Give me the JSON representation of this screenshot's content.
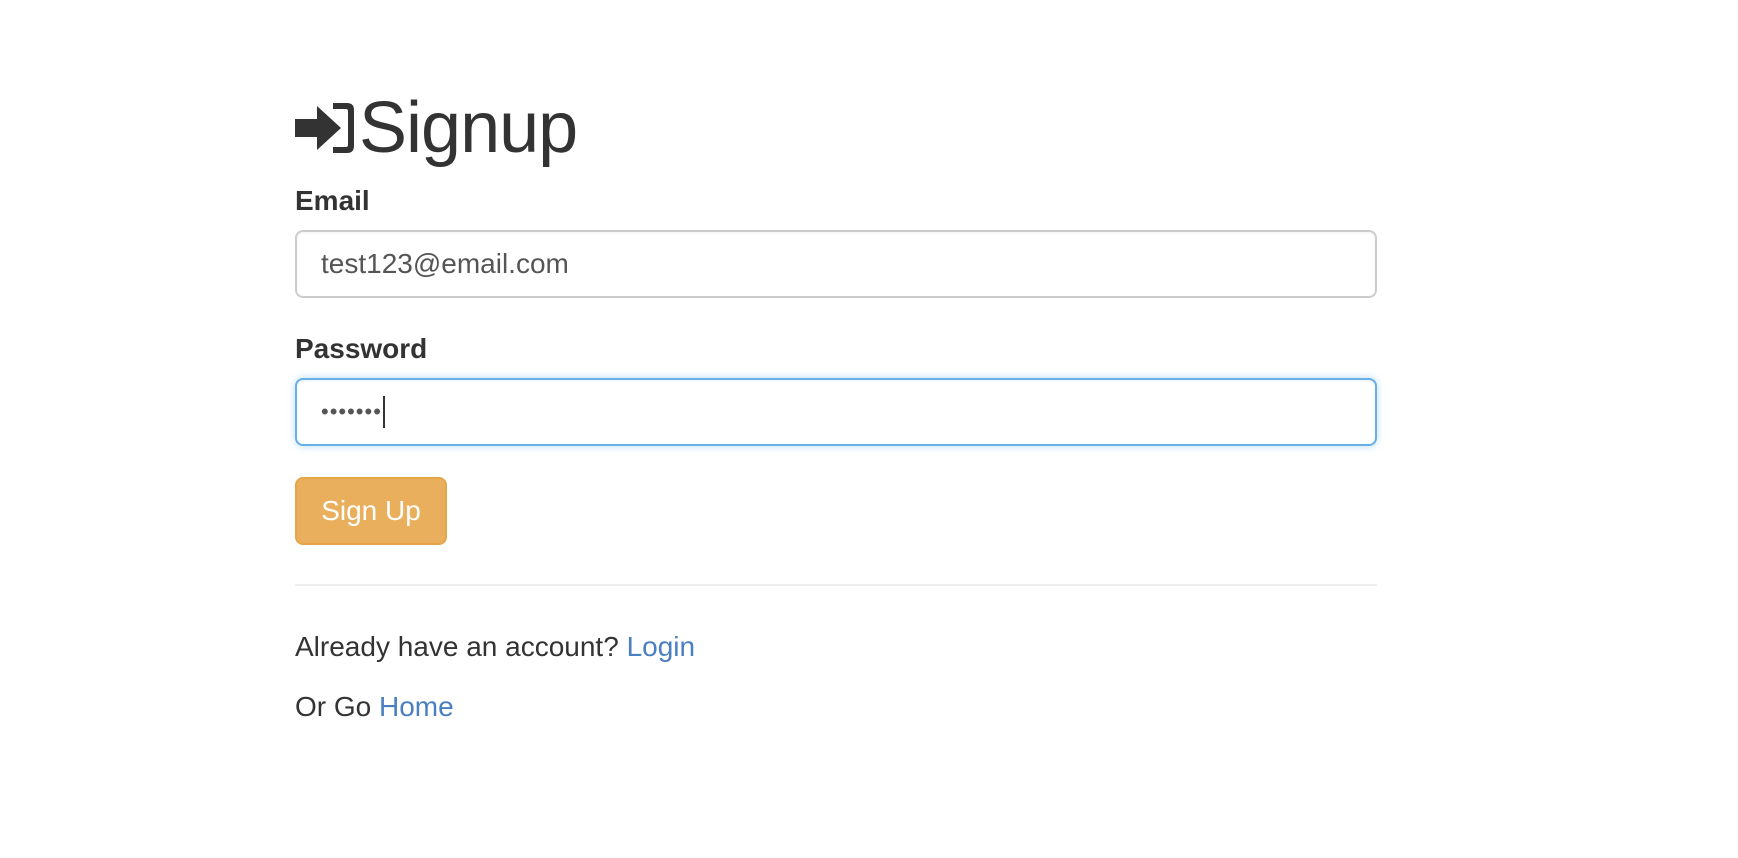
{
  "header": {
    "title": "Signup",
    "icon": "sign-in-icon"
  },
  "form": {
    "email_label": "Email",
    "email_value": "test123@email.com",
    "password_label": "Password",
    "password_value": "•••••••",
    "submit_label": "Sign Up"
  },
  "footer": {
    "login_prompt": "Already have an account?",
    "login_link": "Login",
    "home_prompt": "Or Go",
    "home_link": "Home"
  },
  "colors": {
    "text": "#333333",
    "button": "#e9af5d",
    "link": "#4a7fc1",
    "focus_border": "#66afe9"
  }
}
